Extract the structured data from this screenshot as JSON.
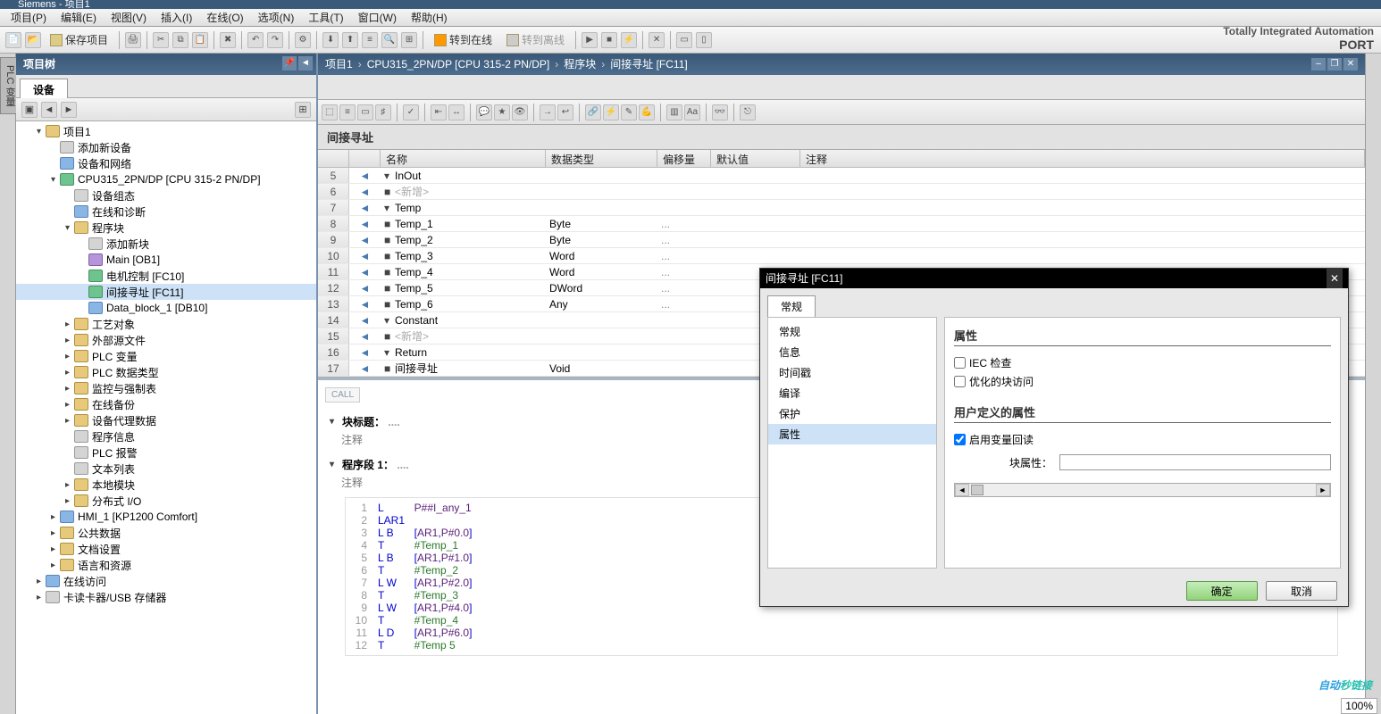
{
  "app_title": "Siemens - 项目1",
  "menu": [
    "项目(P)",
    "编辑(E)",
    "视图(V)",
    "插入(I)",
    "在线(O)",
    "选项(N)",
    "工具(T)",
    "窗口(W)",
    "帮助(H)"
  ],
  "tia_brand": "Totally Integrated Automation",
  "tia_port": "PORT",
  "main_toolbar": {
    "save_label": "保存项目",
    "go_online": "转到在线",
    "go_offline": "转到离线"
  },
  "side_tab": "PLC 变量",
  "project_tree": {
    "header": "项目树",
    "device_tab": "设备",
    "items": [
      {
        "ind": 0,
        "tri": "open",
        "label": "项目1",
        "icon": "folder"
      },
      {
        "ind": 1,
        "tri": "none",
        "label": "添加新设备",
        "icon": "gray"
      },
      {
        "ind": 1,
        "tri": "none",
        "label": "设备和网络",
        "icon": "blue"
      },
      {
        "ind": 1,
        "tri": "open",
        "label": "CPU315_2PN/DP [CPU 315-2 PN/DP]",
        "icon": "green"
      },
      {
        "ind": 2,
        "tri": "none",
        "label": "设备组态",
        "icon": "gray"
      },
      {
        "ind": 2,
        "tri": "none",
        "label": "在线和诊断",
        "icon": "blue"
      },
      {
        "ind": 2,
        "tri": "open",
        "label": "程序块",
        "icon": "folder"
      },
      {
        "ind": 3,
        "tri": "none",
        "label": "添加新块",
        "icon": "gray"
      },
      {
        "ind": 3,
        "tri": "none",
        "label": "Main [OB1]",
        "icon": "purple"
      },
      {
        "ind": 3,
        "tri": "none",
        "label": "电机控制 [FC10]",
        "icon": "green"
      },
      {
        "ind": 3,
        "tri": "none",
        "label": "间接寻址 [FC11]",
        "icon": "green",
        "sel": true
      },
      {
        "ind": 3,
        "tri": "none",
        "label": "Data_block_1 [DB10]",
        "icon": "blue"
      },
      {
        "ind": 2,
        "tri": "closed",
        "label": "工艺对象",
        "icon": "folder"
      },
      {
        "ind": 2,
        "tri": "closed",
        "label": "外部源文件",
        "icon": "folder"
      },
      {
        "ind": 2,
        "tri": "closed",
        "label": "PLC 变量",
        "icon": "folder"
      },
      {
        "ind": 2,
        "tri": "closed",
        "label": "PLC 数据类型",
        "icon": "folder"
      },
      {
        "ind": 2,
        "tri": "closed",
        "label": "监控与强制表",
        "icon": "folder"
      },
      {
        "ind": 2,
        "tri": "closed",
        "label": "在线备份",
        "icon": "folder"
      },
      {
        "ind": 2,
        "tri": "closed",
        "label": "设备代理数据",
        "icon": "folder"
      },
      {
        "ind": 2,
        "tri": "none",
        "label": "程序信息",
        "icon": "gray"
      },
      {
        "ind": 2,
        "tri": "none",
        "label": "PLC 报警",
        "icon": "gray"
      },
      {
        "ind": 2,
        "tri": "none",
        "label": "文本列表",
        "icon": "gray"
      },
      {
        "ind": 2,
        "tri": "closed",
        "label": "本地模块",
        "icon": "folder"
      },
      {
        "ind": 2,
        "tri": "closed",
        "label": "分布式 I/O",
        "icon": "folder"
      },
      {
        "ind": 1,
        "tri": "closed",
        "label": "HMI_1 [KP1200 Comfort]",
        "icon": "blue"
      },
      {
        "ind": 1,
        "tri": "closed",
        "label": "公共数据",
        "icon": "folder"
      },
      {
        "ind": 1,
        "tri": "closed",
        "label": "文档设置",
        "icon": "folder"
      },
      {
        "ind": 1,
        "tri": "closed",
        "label": "语言和资源",
        "icon": "folder"
      },
      {
        "ind": 0,
        "tri": "closed",
        "label": "在线访问",
        "icon": "blue"
      },
      {
        "ind": 0,
        "tri": "closed",
        "label": "卡读卡器/USB 存储器",
        "icon": "gray"
      }
    ]
  },
  "breadcrumb": [
    "项目1",
    "CPU315_2PN/DP [CPU 315-2 PN/DP]",
    "程序块",
    "间接寻址 [FC11]"
  ],
  "block_title": "间接寻址",
  "var_table": {
    "headers": {
      "name": "名称",
      "dtype": "数据类型",
      "offset": "偏移量",
      "default": "默认值",
      "comment": "注释"
    },
    "rows": [
      {
        "rn": 5,
        "arr": "▾",
        "name": "InOut",
        "dtype": "",
        "off": ""
      },
      {
        "rn": 6,
        "arr": "■",
        "name": "<新增>",
        "dtype": "",
        "off": "",
        "faded": true
      },
      {
        "rn": 7,
        "arr": "▾",
        "name": "Temp",
        "dtype": "",
        "off": ""
      },
      {
        "rn": 8,
        "arr": "■",
        "name": "Temp_1",
        "dtype": "Byte",
        "off": "..."
      },
      {
        "rn": 9,
        "arr": "■",
        "name": "Temp_2",
        "dtype": "Byte",
        "off": "..."
      },
      {
        "rn": 10,
        "arr": "■",
        "name": "Temp_3",
        "dtype": "Word",
        "off": "..."
      },
      {
        "rn": 11,
        "arr": "■",
        "name": "Temp_4",
        "dtype": "Word",
        "off": "..."
      },
      {
        "rn": 12,
        "arr": "■",
        "name": "Temp_5",
        "dtype": "DWord",
        "off": "..."
      },
      {
        "rn": 13,
        "arr": "■",
        "name": "Temp_6",
        "dtype": "Any",
        "off": "..."
      },
      {
        "rn": 14,
        "arr": "▾",
        "name": "Constant",
        "dtype": "",
        "off": ""
      },
      {
        "rn": 15,
        "arr": "■",
        "name": "<新增>",
        "dtype": "",
        "off": "",
        "faded": true
      },
      {
        "rn": 16,
        "arr": "▾",
        "name": "Return",
        "dtype": "",
        "off": ""
      },
      {
        "rn": 17,
        "arr": "■",
        "name": "间接寻址",
        "dtype": "Void",
        "off": ""
      }
    ]
  },
  "code": {
    "call": "CALL",
    "block_title_hdr": "块标题：",
    "comment": "注释",
    "network_hdr": "程序段 1：",
    "lines": [
      {
        "ln": 1,
        "i": "L",
        "a": "P##I_any_1",
        "t": "ptr"
      },
      {
        "ln": 2,
        "i": "LAR1",
        "a": "",
        "t": ""
      },
      {
        "ln": 3,
        "i": "L B",
        "a": "[ AR1 , P#0.0 ]",
        "t": "ins2"
      },
      {
        "ln": 4,
        "i": "T",
        "a": "#Temp_1",
        "t": "var"
      },
      {
        "ln": 5,
        "i": "L B",
        "a": "[ AR1 , P#1.0 ]",
        "t": "ins2"
      },
      {
        "ln": 6,
        "i": "T",
        "a": "#Temp_2",
        "t": "var"
      },
      {
        "ln": 7,
        "i": "L W",
        "a": "[ AR1 , P#2.0 ]",
        "t": "ins2"
      },
      {
        "ln": 8,
        "i": "T",
        "a": "#Temp_3",
        "t": "var"
      },
      {
        "ln": 9,
        "i": "L W",
        "a": "[ AR1 , P#4.0 ]",
        "t": "ins2"
      },
      {
        "ln": 10,
        "i": "T",
        "a": "#Temp_4",
        "t": "var"
      },
      {
        "ln": 11,
        "i": "L D",
        "a": "[ AR1 , P#6.0 ]",
        "t": "ins2"
      },
      {
        "ln": 12,
        "i": "T",
        "a": "#Temp 5",
        "t": "var"
      }
    ]
  },
  "dialog": {
    "title": "间接寻址 [FC11]",
    "tab": "常规",
    "nav": [
      "常规",
      "信息",
      "时间戳",
      "编译",
      "保护",
      "属性"
    ],
    "sel_nav": "属性",
    "section1": "属性",
    "chk1": "IEC 检查",
    "chk2": "优化的块访问",
    "section2": "用户定义的属性",
    "chk3": "启用变量回读",
    "field_label": "块属性：",
    "field_value": "",
    "ok": "确定",
    "cancel": "取消"
  },
  "zoom": "100%",
  "watermark": "自动秒链接"
}
